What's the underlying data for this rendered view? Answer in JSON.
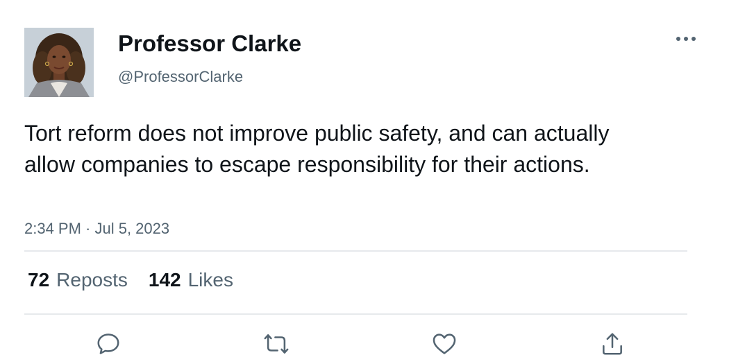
{
  "author": {
    "display_name": "Professor Clarke",
    "handle": "@ProfessorClarke",
    "avatar_icon": "avatar-photo"
  },
  "tweet": {
    "text": "Tort reform does not improve public safety, and can actually allow companies to escape responsibility for their actions.",
    "timestamp": "2:34 PM · Jul 5, 2023"
  },
  "stats": {
    "reposts_count": "72",
    "reposts_label": "Reposts",
    "likes_count": "142",
    "likes_label": "Likes"
  },
  "actions": {
    "more": "more-horizontal-icon",
    "reply": "reply-icon",
    "repost": "repost-icon",
    "like": "heart-icon",
    "share": "share-icon"
  },
  "colors": {
    "text_primary": "#0f1419",
    "text_secondary": "#536471",
    "divider": "#e6e9ec",
    "background": "#ffffff"
  }
}
